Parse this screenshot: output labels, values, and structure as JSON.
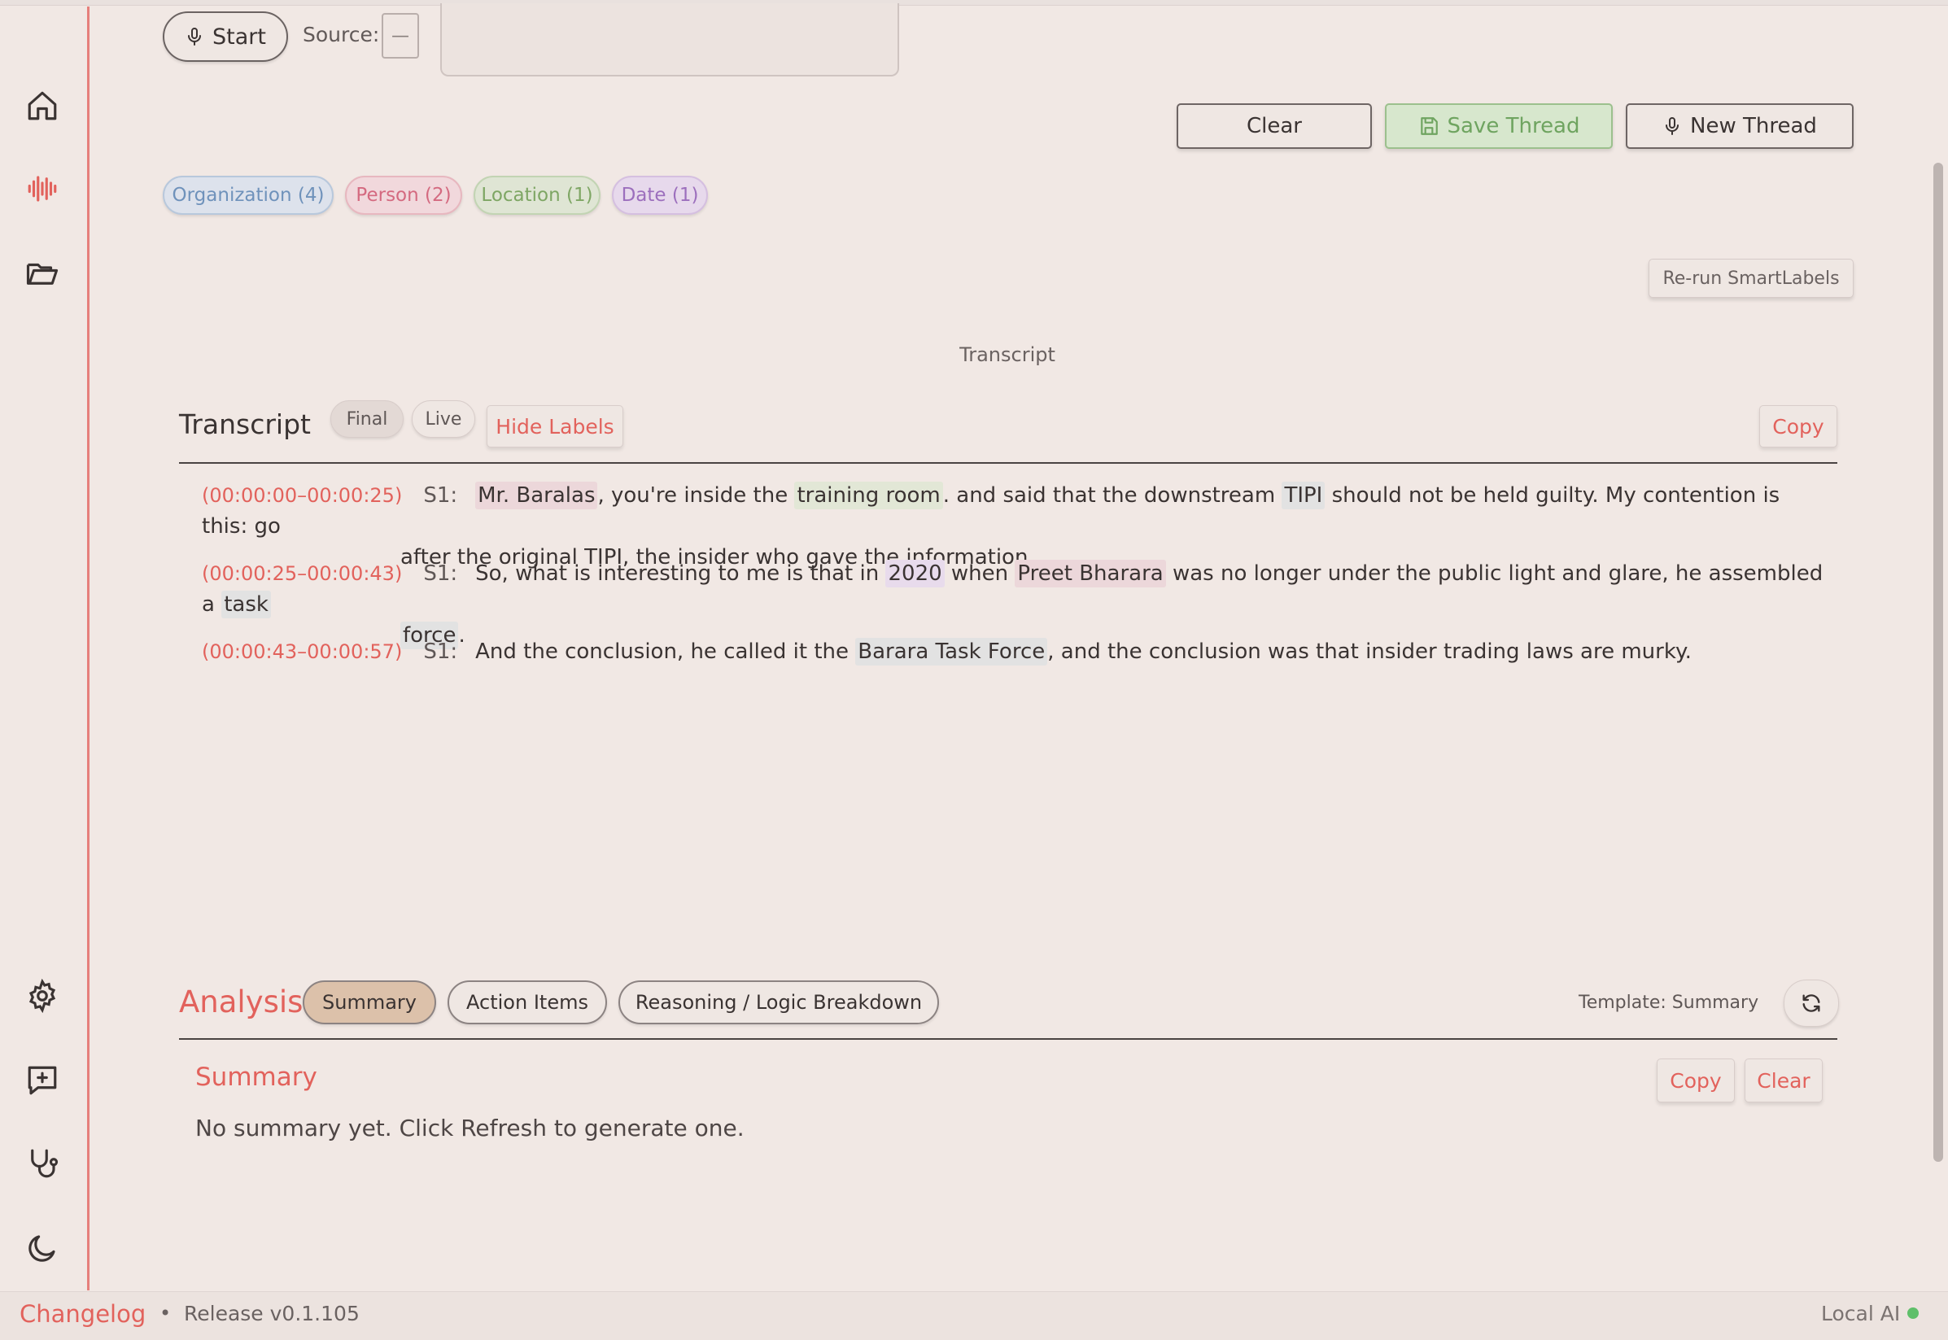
{
  "controls": {
    "start_label": "Start",
    "source_label": "Source:",
    "source_value": "—"
  },
  "actions": {
    "clear_label": "Clear",
    "save_label": "Save Thread",
    "new_label": "New Thread"
  },
  "entities": [
    {
      "label": "Organization (4)",
      "color": "#6f92bb"
    },
    {
      "label": "Person (2)",
      "color": "#d46a80"
    },
    {
      "label": "Location (1)",
      "color": "#7ea664"
    },
    {
      "label": "Date (1)",
      "color": "#9c6fbd"
    }
  ],
  "rerun_label": "Re-run SmartLabels",
  "transcript_center_label": "Transcript",
  "transcript": {
    "title": "Transcript",
    "modes": [
      "Final",
      "Live"
    ],
    "hide_labels": "Hide Labels",
    "copy_label": "Copy",
    "segments": [
      {
        "time": "(00:00:00–00:00:25)",
        "speaker": "S1:",
        "parts": [
          {
            "text": "Mr. Baralas",
            "entity": "person"
          },
          {
            "text": ", you're inside the "
          },
          {
            "text": "training room",
            "entity": "loc"
          },
          {
            "text": ". and said that the downstream "
          },
          {
            "text": "TIPI",
            "entity": "org"
          },
          {
            "text": " should not be held guilty. My contention is this: go"
          }
        ],
        "cont": "after the original TIPI, the insider who gave the information."
      },
      {
        "time": "(00:00:25–00:00:43)",
        "speaker": "S1:",
        "parts": [
          {
            "text": "So, what is interesting to me is that in "
          },
          {
            "text": "2020",
            "entity": "date"
          },
          {
            "text": " when "
          },
          {
            "text": "Preet Bharara",
            "entity": "person"
          },
          {
            "text": " was no longer under the public light and glare, he assembled a "
          },
          {
            "text": "task",
            "entity": "org"
          }
        ],
        "cont_entity": "force",
        "cont_tail": "."
      },
      {
        "time": "(00:00:43–00:00:57)",
        "speaker": "S1:",
        "parts": [
          {
            "text": "And the conclusion, he called it the "
          },
          {
            "text": "Barara Task Force",
            "entity": "org"
          },
          {
            "text": ", and the conclusion was that insider trading laws are murky."
          }
        ]
      }
    ]
  },
  "analysis": {
    "title": "Analysis",
    "tabs": [
      "Summary",
      "Action Items",
      "Reasoning / Logic Breakdown"
    ],
    "active_tab": "Summary",
    "template_label": "Template: Summary",
    "summary_title": "Summary",
    "copy_label": "Copy",
    "clear_label": "Clear",
    "summary_text": "No summary yet. Click Refresh to generate one."
  },
  "footer": {
    "changelog": "Changelog",
    "separator": "•",
    "release": "Release v0.1.105",
    "local_ai": "Local AI",
    "status_color": "#5fbf6a"
  },
  "sidebar": {
    "icons": [
      "home-icon",
      "waveform-icon",
      "folder-icon",
      "gear-icon",
      "message-plus-icon",
      "stethoscope-icon",
      "moon-icon"
    ]
  }
}
